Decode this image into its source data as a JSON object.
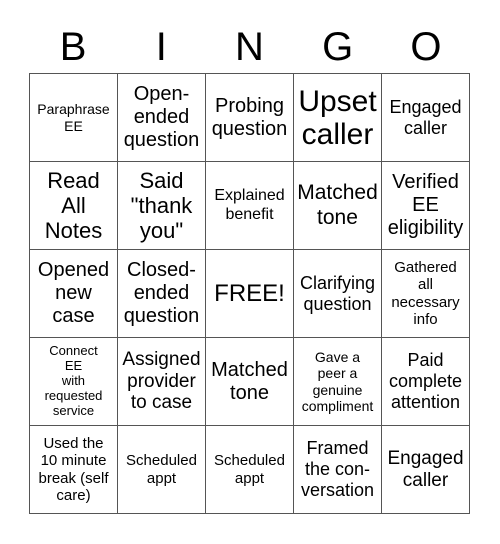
{
  "header": {
    "letters": [
      "B",
      "I",
      "N",
      "G",
      "O"
    ]
  },
  "board": {
    "rows": [
      [
        "Paraphrase\nEE",
        "Open-\nended\nquestion",
        "Probing\nquestion",
        "Upset\ncaller",
        "Engaged\ncaller"
      ],
      [
        "Read\nAll\nNotes",
        "Said\n\"thank\nyou\"",
        "Explained\nbenefit",
        "Matched\ntone",
        "Verified\nEE\neligibility"
      ],
      [
        "Opened\nnew\ncase",
        "Closed-\nended\nquestion",
        "FREE!",
        "Clarifying\nquestion",
        "Gathered\nall\nnecessary\ninfo"
      ],
      [
        "Connect\nEE\nwith\nrequested\nservice",
        "Assigned\nprovider\nto case",
        "Matched\ntone",
        "Gave a\npeer a\ngenuine\ncompliment",
        "Paid\ncomplete\nattention"
      ],
      [
        "Used the\n10 minute\nbreak (self\ncare)",
        "Scheduled\nappt",
        "Scheduled\nappt",
        "Framed\nthe con-\nversation",
        "Engaged\ncaller"
      ]
    ]
  }
}
